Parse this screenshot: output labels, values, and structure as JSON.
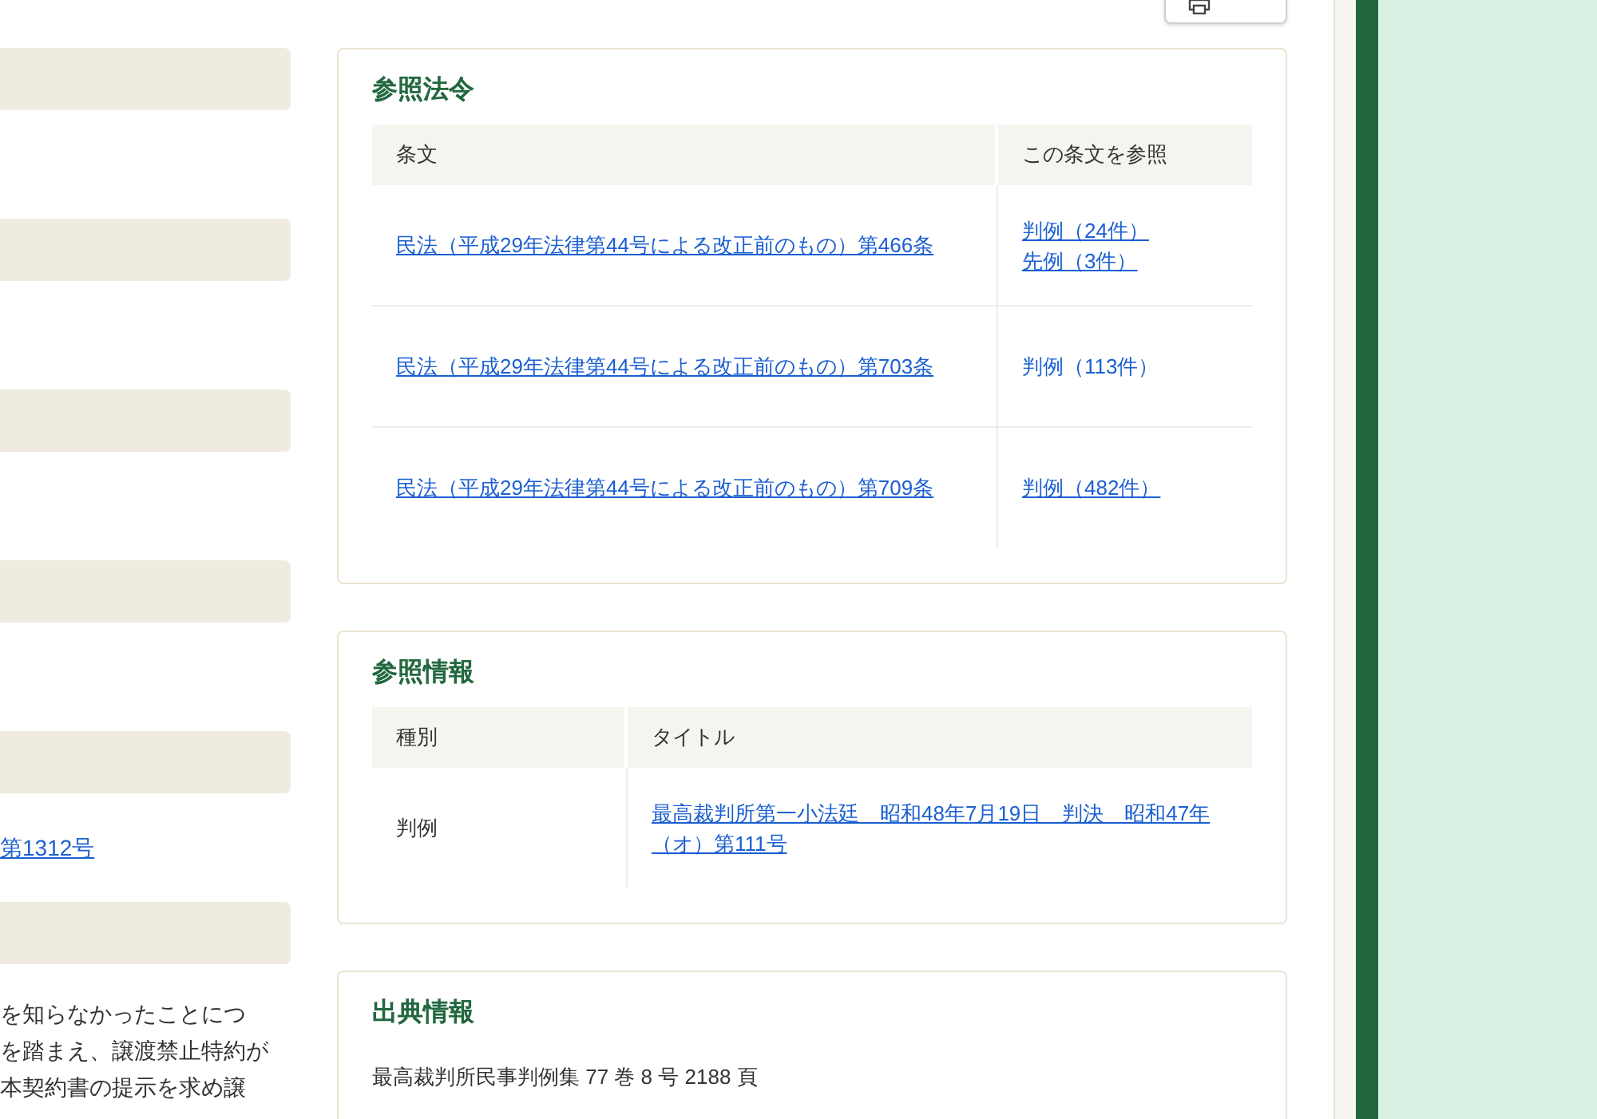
{
  "left_column": {
    "case_number_link": "第1312号",
    "summary_lines": [
      "を知らなかったことにつ",
      "を踏まえ、譲渡禁止特約が",
      "本契約書の提示を求め譲"
    ]
  },
  "referenced_laws": {
    "title": "参照法令",
    "columns": [
      "条文",
      "この条文を参照"
    ],
    "rows": [
      {
        "article": "民法（平成29年法律第44号による改正前のもの）第466条",
        "references": [
          {
            "label": "判例（24件）",
            "underlined": true
          },
          {
            "label": "先例（3件）",
            "underlined": true
          }
        ]
      },
      {
        "article": "民法（平成29年法律第44号による改正前のもの）第703条",
        "references": [
          {
            "label": "判例（113件）",
            "underlined": false
          }
        ]
      },
      {
        "article": "民法（平成29年法律第44号による改正前のもの）第709条",
        "references": [
          {
            "label": "判例（482件）",
            "underlined": true
          }
        ]
      }
    ]
  },
  "reference_info": {
    "title": "参照情報",
    "columns": [
      "種別",
      "タイトル"
    ],
    "rows": [
      {
        "type": "判例",
        "title": "最高裁判所第一小法廷　昭和48年7月19日　判決　昭和47年（オ）第111号"
      }
    ]
  },
  "source_info": {
    "title": "出典情報",
    "text": "最高裁判所民事判例集 77 巻 8 号 2188 頁"
  }
}
